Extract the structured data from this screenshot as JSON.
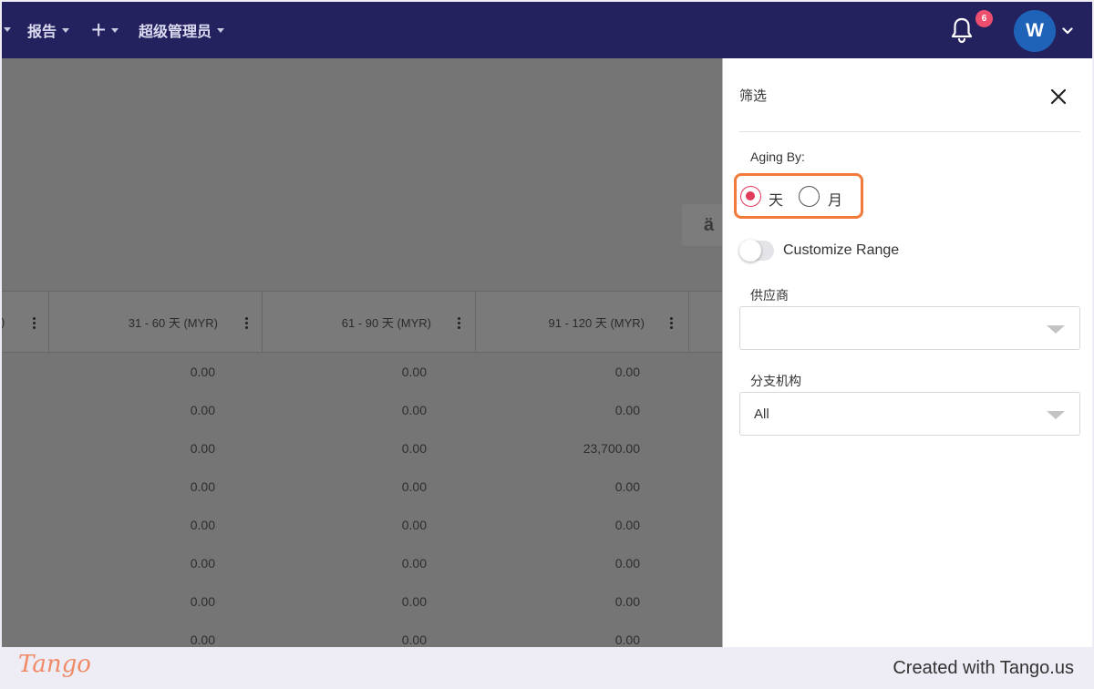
{
  "topnav": {
    "items": [
      {
        "label": "报告"
      },
      {
        "label": "+"
      },
      {
        "label": "超级管理员"
      }
    ],
    "notification_count": "6",
    "avatar_initial": "W",
    "colors": {
      "background": "#24215f",
      "badge": "#ef4f6f",
      "avatar": "#1e63b8"
    }
  },
  "table": {
    "columns": [
      {
        "label": "31 - 60 天 (MYR)"
      },
      {
        "label": "61 - 90 天 (MYR)"
      },
      {
        "label": "91 - 120 天 (MYR)"
      }
    ],
    "rows": [
      [
        "0.00",
        "0.00",
        "0.00"
      ],
      [
        "0.00",
        "0.00",
        "0.00"
      ],
      [
        "0.00",
        "0.00",
        "23,700.00"
      ],
      [
        "0.00",
        "0.00",
        "0.00"
      ],
      [
        "0.00",
        "0.00",
        "0.00"
      ],
      [
        "0.00",
        "0.00",
        "0.00"
      ],
      [
        "0.00",
        "0.00",
        "0.00"
      ],
      [
        "0.00",
        "0.00",
        "0.00"
      ]
    ]
  },
  "filter_panel": {
    "title": "筛选",
    "aging_by_label": "Aging By:",
    "options": [
      {
        "label": "天",
        "checked": true
      },
      {
        "label": "月",
        "checked": false
      }
    ],
    "customize_range_label": "Customize Range",
    "customize_range_enabled": false,
    "supplier_label": "供应商",
    "supplier_value": "",
    "branch_label": "分支机构",
    "branch_value": "All",
    "colors": {
      "radio_checked": "#e23a5a",
      "highlight": "#f27a3a"
    }
  },
  "footer": {
    "logo_text": "Tango",
    "created_text": "Created with Tango.us"
  }
}
